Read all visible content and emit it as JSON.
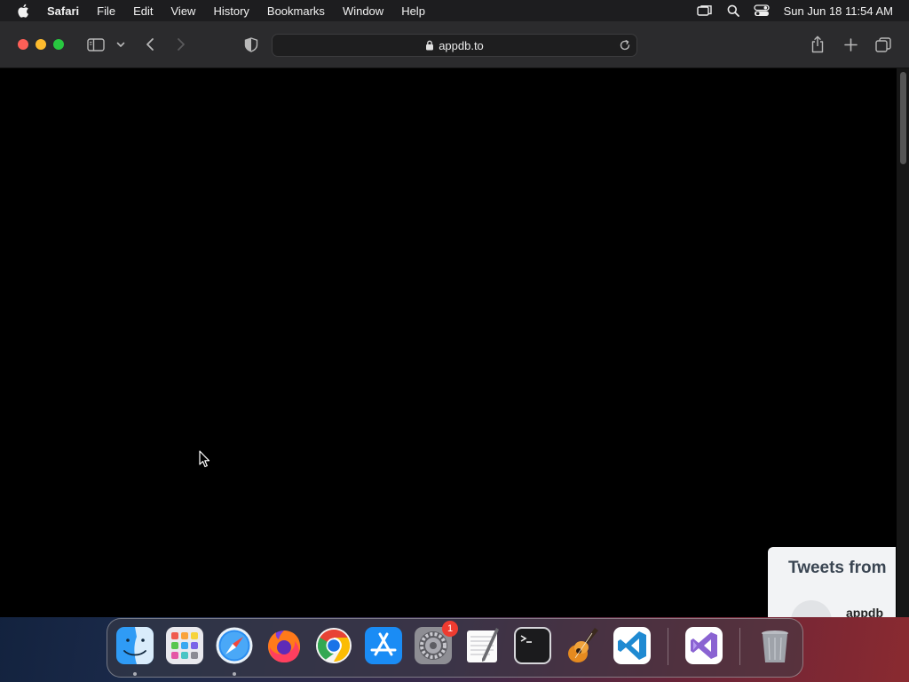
{
  "menubar": {
    "app_name": "Safari",
    "items": [
      "File",
      "Edit",
      "View",
      "History",
      "Bookmarks",
      "Window",
      "Help"
    ],
    "clock": "Sun Jun 18  11:54 AM",
    "status_icons": [
      "screen-mirroring-icon",
      "spotlight-search-icon",
      "control-center-icon"
    ]
  },
  "toolbar": {
    "url": "appdb.to"
  },
  "page": {
    "background": "#000000",
    "widget": {
      "title": "Tweets from",
      "handle": "appdb"
    }
  },
  "dock": {
    "apps": [
      {
        "name": "Finder",
        "icon": "finder-icon",
        "running": true
      },
      {
        "name": "Launchpad",
        "icon": "launchpad-icon",
        "running": false
      },
      {
        "name": "Safari",
        "icon": "safari-icon",
        "running": true
      },
      {
        "name": "Firefox",
        "icon": "firefox-icon",
        "running": false
      },
      {
        "name": "Google Chrome",
        "icon": "chrome-icon",
        "running": false
      },
      {
        "name": "App Store",
        "icon": "app-store-icon",
        "running": false
      },
      {
        "name": "System Settings",
        "icon": "system-settings-icon",
        "running": false,
        "badge": "1"
      },
      {
        "name": "TextEdit",
        "icon": "textedit-icon",
        "running": false
      },
      {
        "name": "Terminal",
        "icon": "terminal-icon",
        "running": false
      },
      {
        "name": "GarageBand",
        "icon": "garageband-icon",
        "running": false
      },
      {
        "name": "Visual Studio Code",
        "icon": "vscode-icon",
        "running": false
      },
      {
        "name": "Visual Studio",
        "icon": "visual-studio-icon",
        "running": false
      },
      {
        "name": "Trash",
        "icon": "trash-icon",
        "running": false
      }
    ]
  },
  "colors": {
    "close": "#fe5f57",
    "minimize": "#febc2e",
    "maximize": "#28c840",
    "badge": "#ee3b30"
  }
}
